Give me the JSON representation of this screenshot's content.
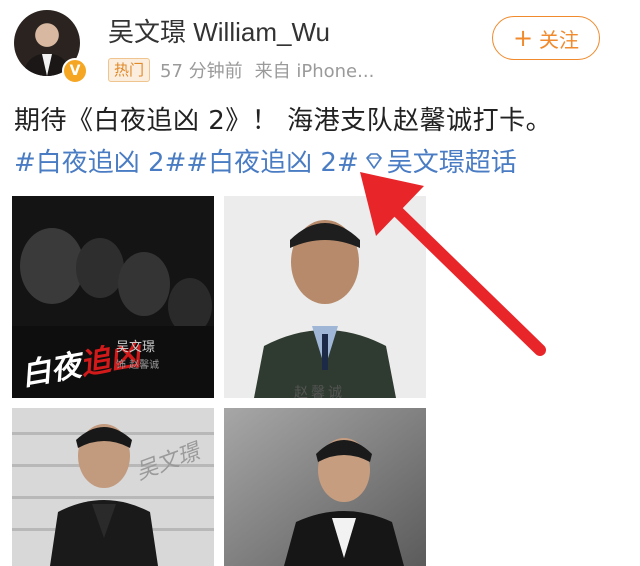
{
  "user": {
    "name": "吴文璟 William_Wu",
    "verified_badge": "V"
  },
  "meta": {
    "tag": "热门",
    "time": "57 分钟前",
    "source": "来自 iPhone..."
  },
  "follow": {
    "plus": "+",
    "label": "关注"
  },
  "post": {
    "text": "期待《白夜追凶 2》！ 海港支队赵馨诚打卡。",
    "topic1": "#白夜追凶 2##白夜追凶 2#",
    "supertopic": "吴文璟超话"
  },
  "photos": {
    "poster_title_white": "白夜",
    "poster_title_red": "追凶",
    "poster_actor": "吴文璟",
    "poster_role": "饰 赵馨诚",
    "id_name": "赵馨诚",
    "signature": "吴文璟"
  },
  "colors": {
    "link": "#4a7cc4",
    "orange": "#f08a2c",
    "arrow": "#e8262a"
  },
  "icons": {
    "supertopic_icon": "diamond-icon",
    "annotation": "red-arrow"
  }
}
